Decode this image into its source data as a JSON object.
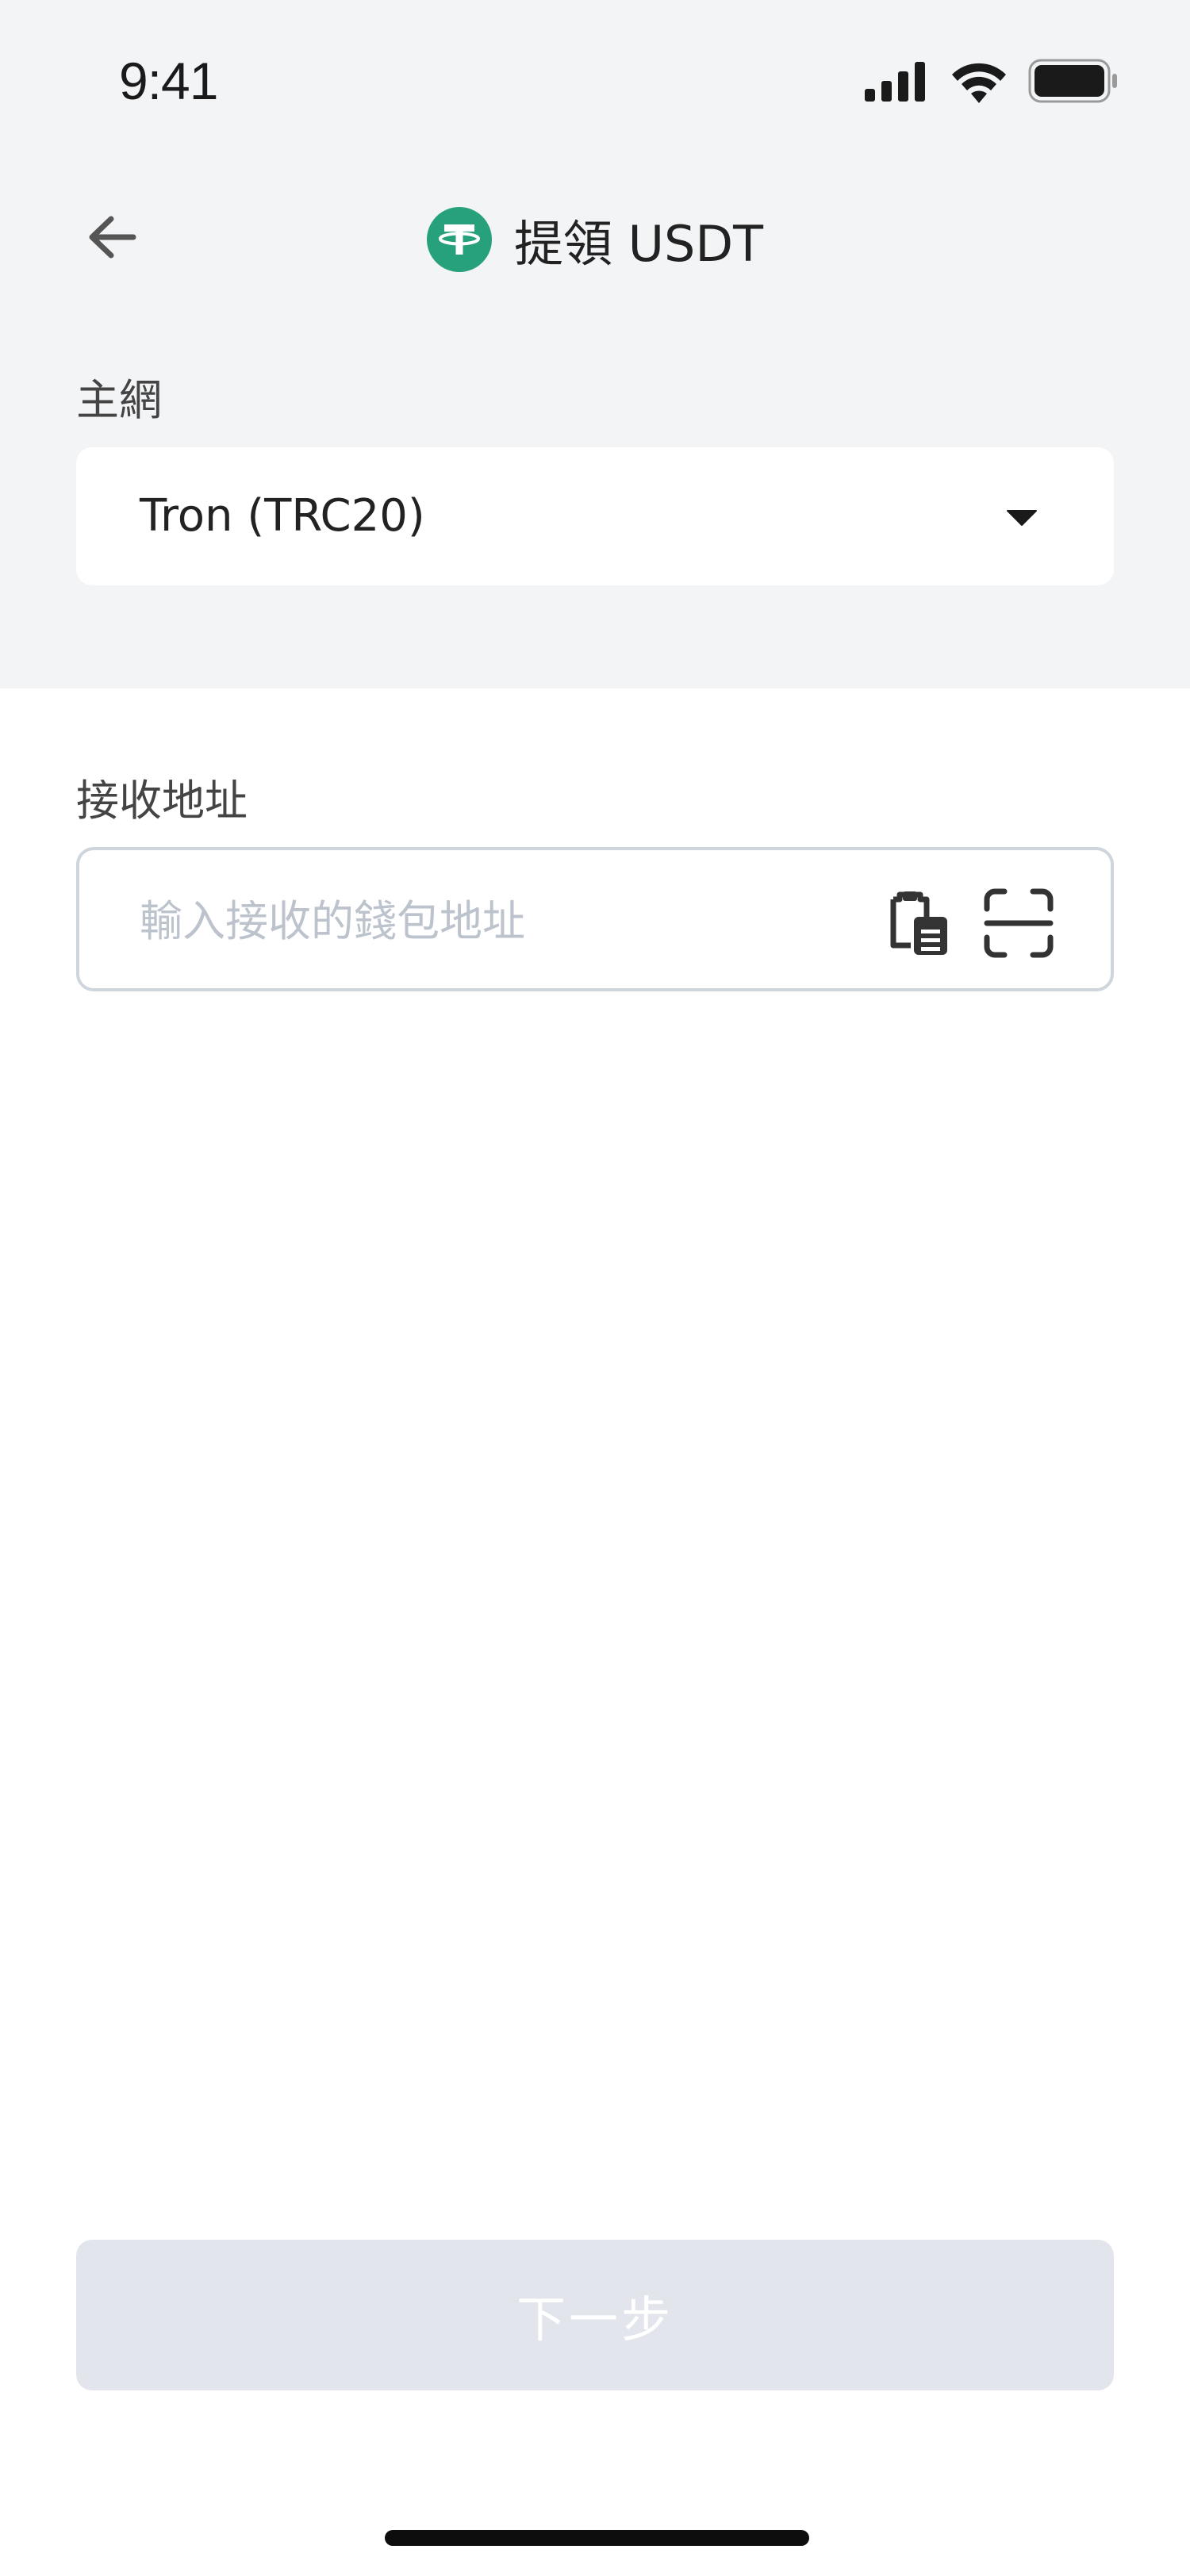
{
  "status_bar": {
    "time": "9:41",
    "icons": [
      "cellular-signal-icon",
      "wifi-icon",
      "battery-icon"
    ]
  },
  "header": {
    "back_icon": "arrow-left-icon",
    "coin_icon": "usdt-tether-icon",
    "title": "提領 USDT"
  },
  "network": {
    "label": "主網",
    "selected": "Tron (TRC20)",
    "caret_icon": "caret-down-icon"
  },
  "address": {
    "label": "接收地址",
    "placeholder": "輸入接收的錢包地址",
    "value": "",
    "paste_icon": "clipboard-paste-icon",
    "scan_icon": "scan-qr-icon"
  },
  "footer": {
    "next_label": "下一步",
    "next_enabled": false
  },
  "colors": {
    "background_top": "#f3f4f6",
    "coin_green": "#26a17b",
    "button_disabled": "#e2e5eb",
    "input_border": "#cfd5dc",
    "placeholder": "#bcc3cc"
  }
}
